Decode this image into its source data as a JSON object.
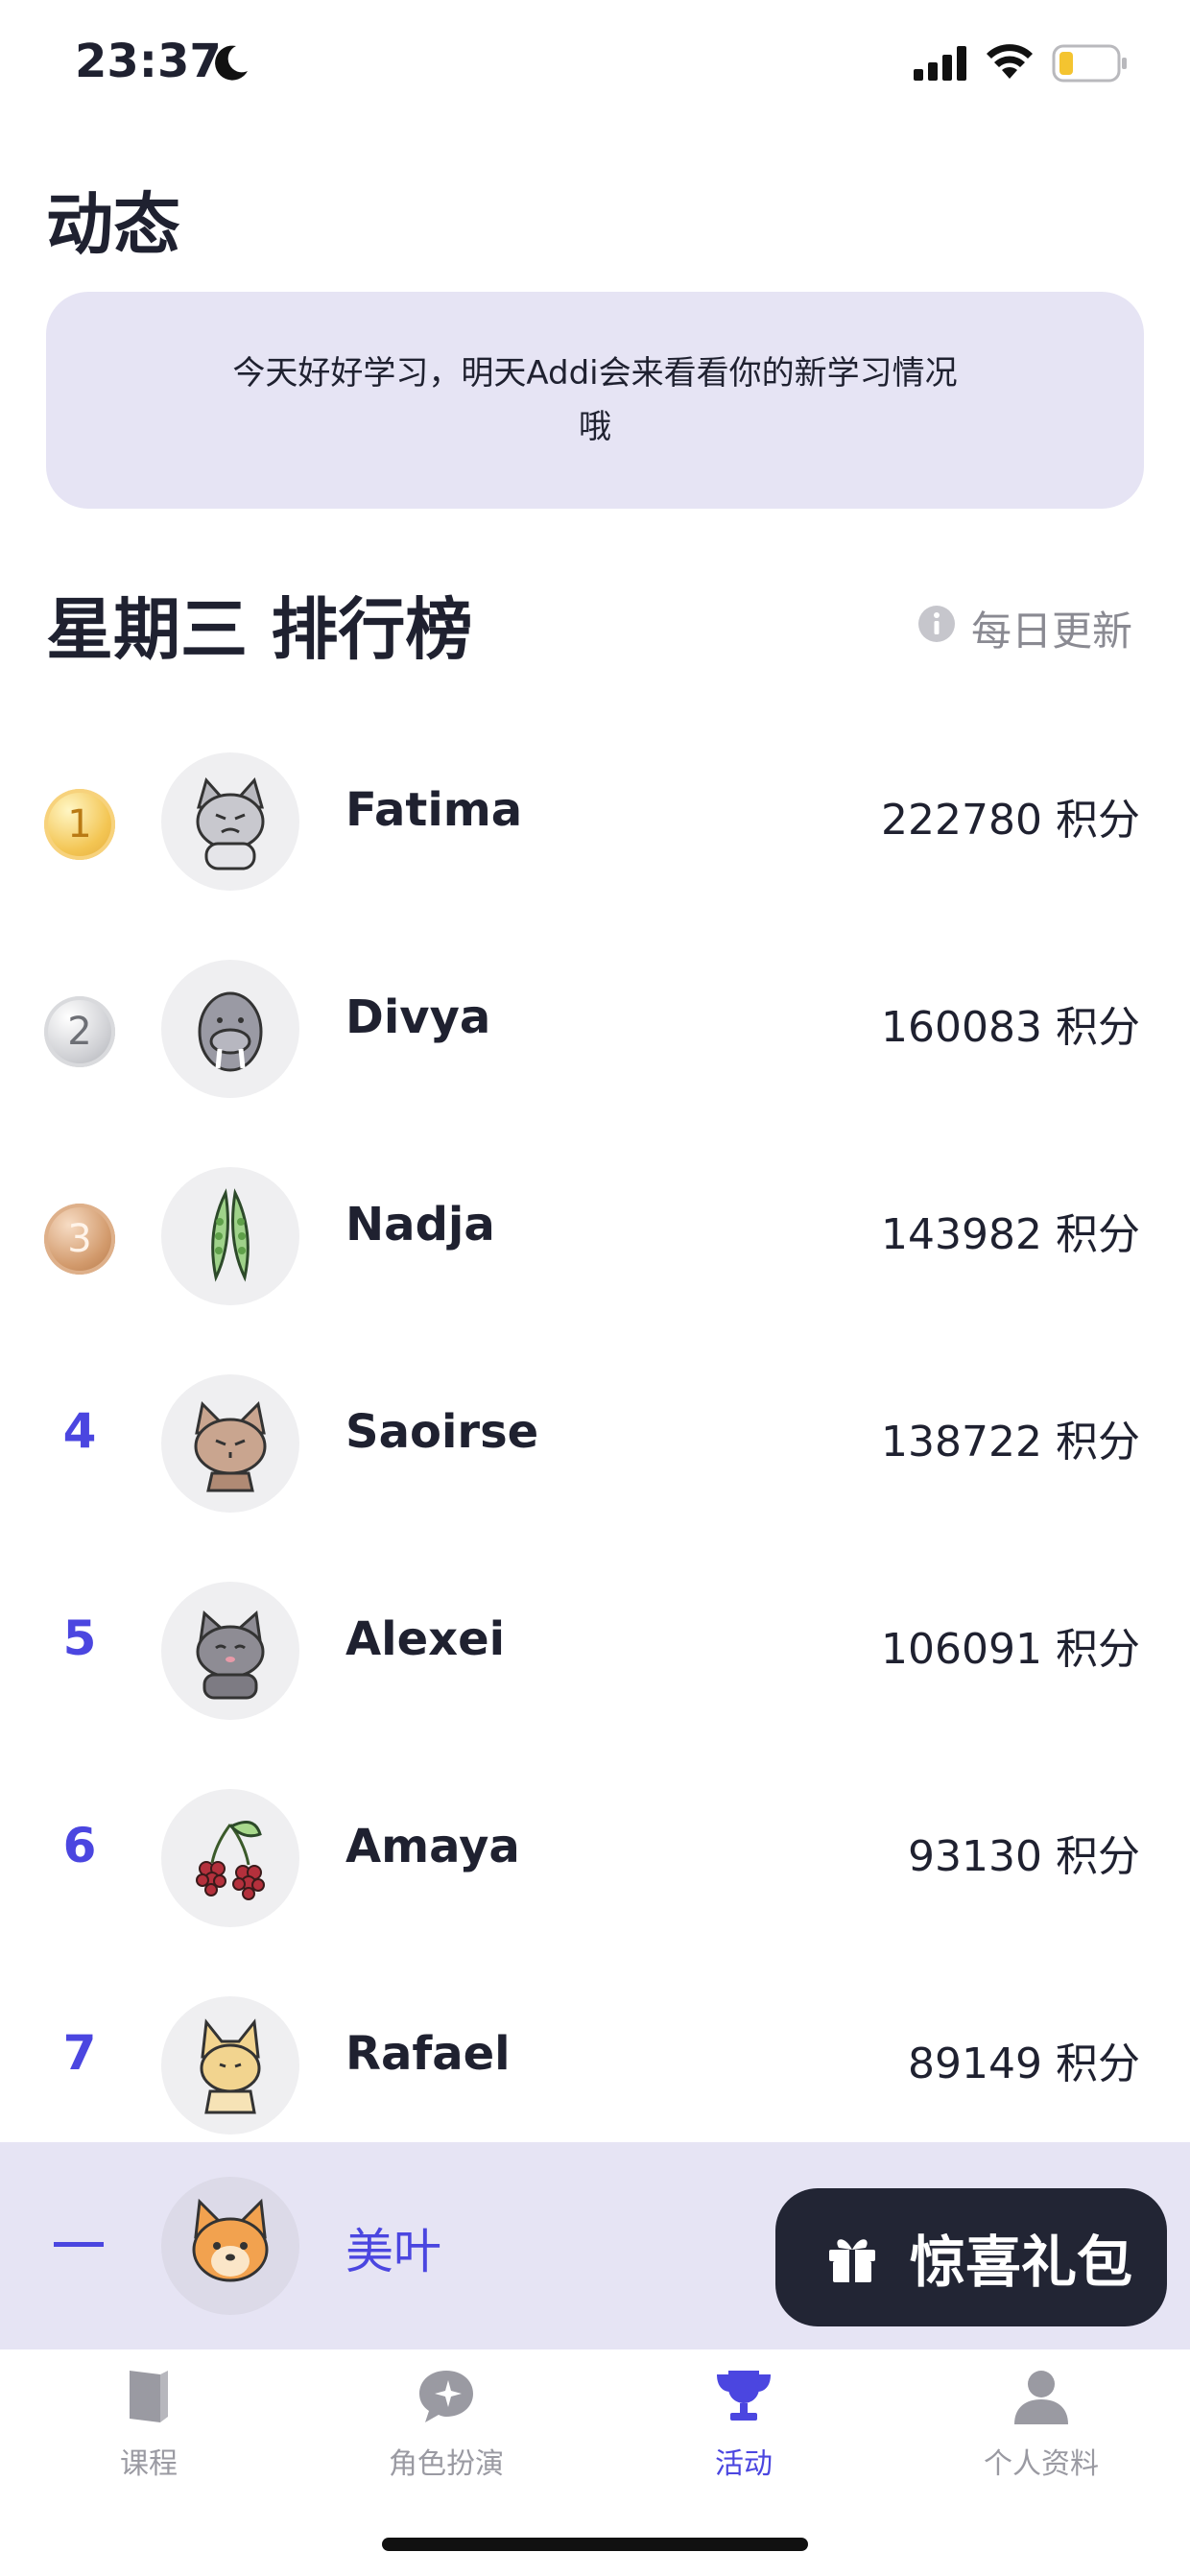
{
  "status_bar": {
    "time": "23:37"
  },
  "page_title": "动态",
  "banner": {
    "text": "今天好好学习，明天Addi会来看看你的新学习情况哦"
  },
  "leaderboard": {
    "title": "星期三 排行榜",
    "update_note": "每日更新",
    "entries": [
      {
        "rank": "1",
        "medal": "gold",
        "name": "Fatima",
        "score": "222780 积分",
        "avatar": "grumpy-cat-avatar"
      },
      {
        "rank": "2",
        "medal": "silver",
        "name": "Divya",
        "score": "160083 积分",
        "avatar": "walrus-avatar"
      },
      {
        "rank": "3",
        "medal": "bronze",
        "name": "Nadja",
        "score": "143982 积分",
        "avatar": "pea-pod-avatar"
      },
      {
        "rank": "4",
        "medal": "",
        "name": "Saoirse",
        "score": "138722 积分",
        "avatar": "tabby-cat-avatar"
      },
      {
        "rank": "5",
        "medal": "",
        "name": "Alexei",
        "score": "106091 积分",
        "avatar": "gray-cat-avatar"
      },
      {
        "rank": "6",
        "medal": "",
        "name": "Amaya",
        "score": "93130 积分",
        "avatar": "berries-avatar"
      },
      {
        "rank": "7",
        "medal": "",
        "name": "Rafael",
        "score": "89149 积分",
        "avatar": "lynx-avatar"
      }
    ]
  },
  "current_user": {
    "rank": "—",
    "name": "美叶",
    "avatar": "corgi-avatar"
  },
  "gift_button": {
    "label": "惊喜礼包",
    "icon": "gift-icon"
  },
  "tabs": [
    {
      "label": "课程",
      "icon": "book-icon",
      "active": false
    },
    {
      "label": "角色扮演",
      "icon": "chat-sparkle-icon",
      "active": false
    },
    {
      "label": "活动",
      "icon": "trophy-icon",
      "active": true
    },
    {
      "label": "个人资料",
      "icon": "person-icon",
      "active": false
    }
  ],
  "colors": {
    "accent": "#4b46e0",
    "banner_bg": "#e6e4f4",
    "dark_button": "#222534"
  }
}
